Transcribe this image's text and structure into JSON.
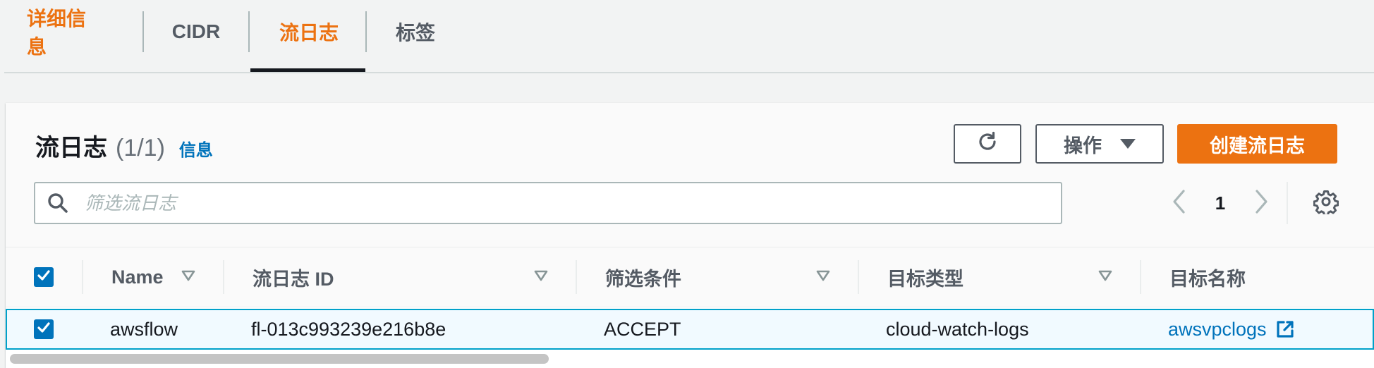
{
  "tabs": [
    {
      "label": "详细信息"
    },
    {
      "label": "CIDR"
    },
    {
      "label": "流日志"
    },
    {
      "label": "标签"
    }
  ],
  "panel": {
    "title": "流日志",
    "count": "(1/1)",
    "info_link": "信息",
    "actions_label": "操作",
    "create_label": "创建流日志",
    "search_placeholder": "筛选流日志",
    "page_number": "1"
  },
  "table": {
    "columns": [
      {
        "label": "Name"
      },
      {
        "label": "流日志 ID"
      },
      {
        "label": "筛选条件"
      },
      {
        "label": "目标类型"
      },
      {
        "label": "目标名称"
      }
    ],
    "rows": [
      {
        "name": "awsflow",
        "flow_log_id": "fl-013c993239e216b8e",
        "filter": "ACCEPT",
        "destination_type": "cloud-watch-logs",
        "destination_name": "awsvpclogs",
        "selected": true
      }
    ],
    "header_checkbox_checked": true
  },
  "colors": {
    "accent_orange": "#ec7211",
    "link_blue": "#0073bb",
    "selected_row_border": "#00a1c9"
  },
  "icons": {
    "refresh": "refresh-icon",
    "caret": "caret-down-icon",
    "search": "search-icon",
    "prev": "chevron-left-icon",
    "next": "chevron-right-icon",
    "settings": "gear-icon",
    "sort": "sort-triangle-icon",
    "external": "external-link-icon",
    "check": "check-icon"
  }
}
